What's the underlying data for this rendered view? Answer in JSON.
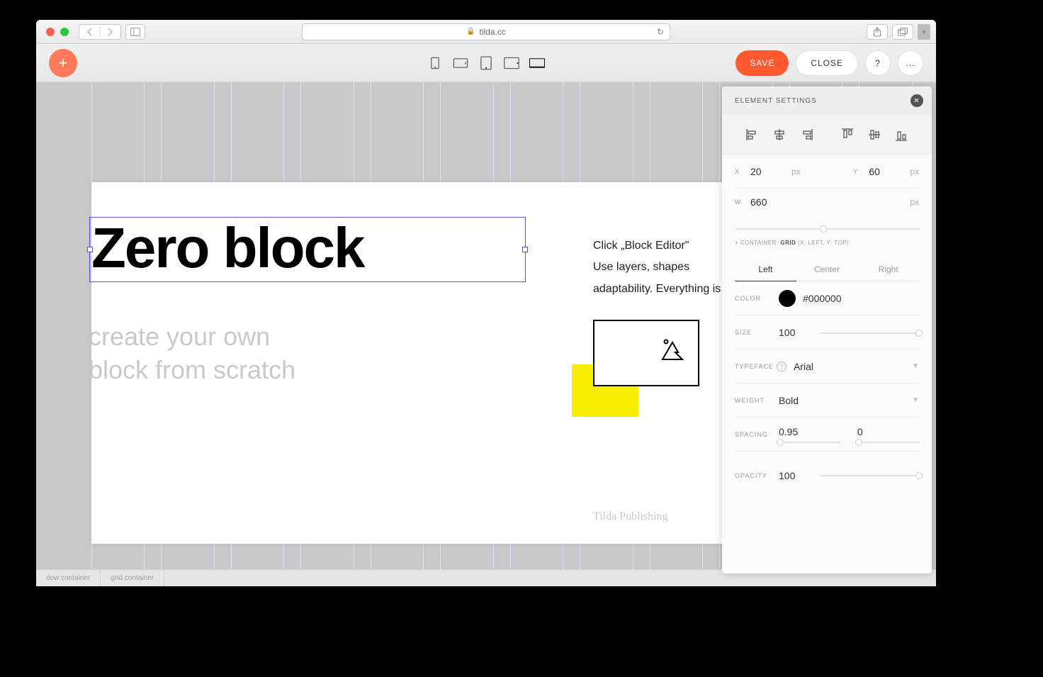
{
  "browser": {
    "url": "tilda.cc"
  },
  "toolbar": {
    "save_label": "SAVE",
    "close_label": "CLOSE",
    "help_label": "?",
    "more_label": "..."
  },
  "canvas": {
    "heading": "Zero block",
    "subheading_l1": "create your own",
    "subheading_l2": "block from scratch",
    "paragraph_l1": "Click „Block Editor\"",
    "paragraph_l2": "Use layers, shapes",
    "paragraph_l3": "adaptability. Everything is in your hands.",
    "credit": "Tilda Publishing"
  },
  "statusbar": {
    "item1": "dow container",
    "item2": "grid container"
  },
  "panel": {
    "title": "ELEMENT SETTINGS",
    "position": {
      "x_label": "X",
      "x_value": "20",
      "x_unit": "px",
      "y_label": "Y",
      "y_value": "60",
      "y_unit": "px",
      "w_label": "W",
      "w_value": "660",
      "w_unit": "px"
    },
    "container_meta_prefix": "+ CONTAINER: ",
    "container_meta_grid": "GRID",
    "container_meta_xy": " (X: LEFT, Y: TOP)",
    "tabs": {
      "left": "Left",
      "center": "Center",
      "right": "Right"
    },
    "color_label": "COLOR",
    "color_value": "#000000",
    "size_label": "SIZE",
    "size_value": "100",
    "typeface_label": "TYPEFACE",
    "typeface_value": "Arial",
    "weight_label": "WEIGHT",
    "weight_value": "Bold",
    "spacing_label": "SPACING",
    "spacing_value1": "0.95",
    "spacing_value2": "0",
    "opacity_label": "OPACITY",
    "opacity_value": "100"
  }
}
